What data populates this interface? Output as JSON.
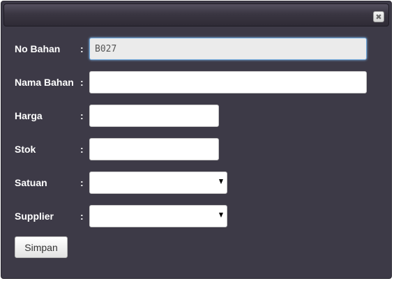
{
  "dialog": {
    "close_icon": "close-icon",
    "close_glyph": "✖"
  },
  "form": {
    "separator": ":",
    "fields": {
      "no_bahan": {
        "label": "No Bahan",
        "value": "B027"
      },
      "nama_bahan": {
        "label": "Nama Bahan",
        "value": ""
      },
      "harga": {
        "label": "Harga",
        "value": ""
      },
      "stok": {
        "label": "Stok",
        "value": ""
      },
      "satuan": {
        "label": "Satuan",
        "selected": ""
      },
      "supplier": {
        "label": "Supplier",
        "selected": ""
      }
    },
    "submit_label": "Simpan"
  }
}
